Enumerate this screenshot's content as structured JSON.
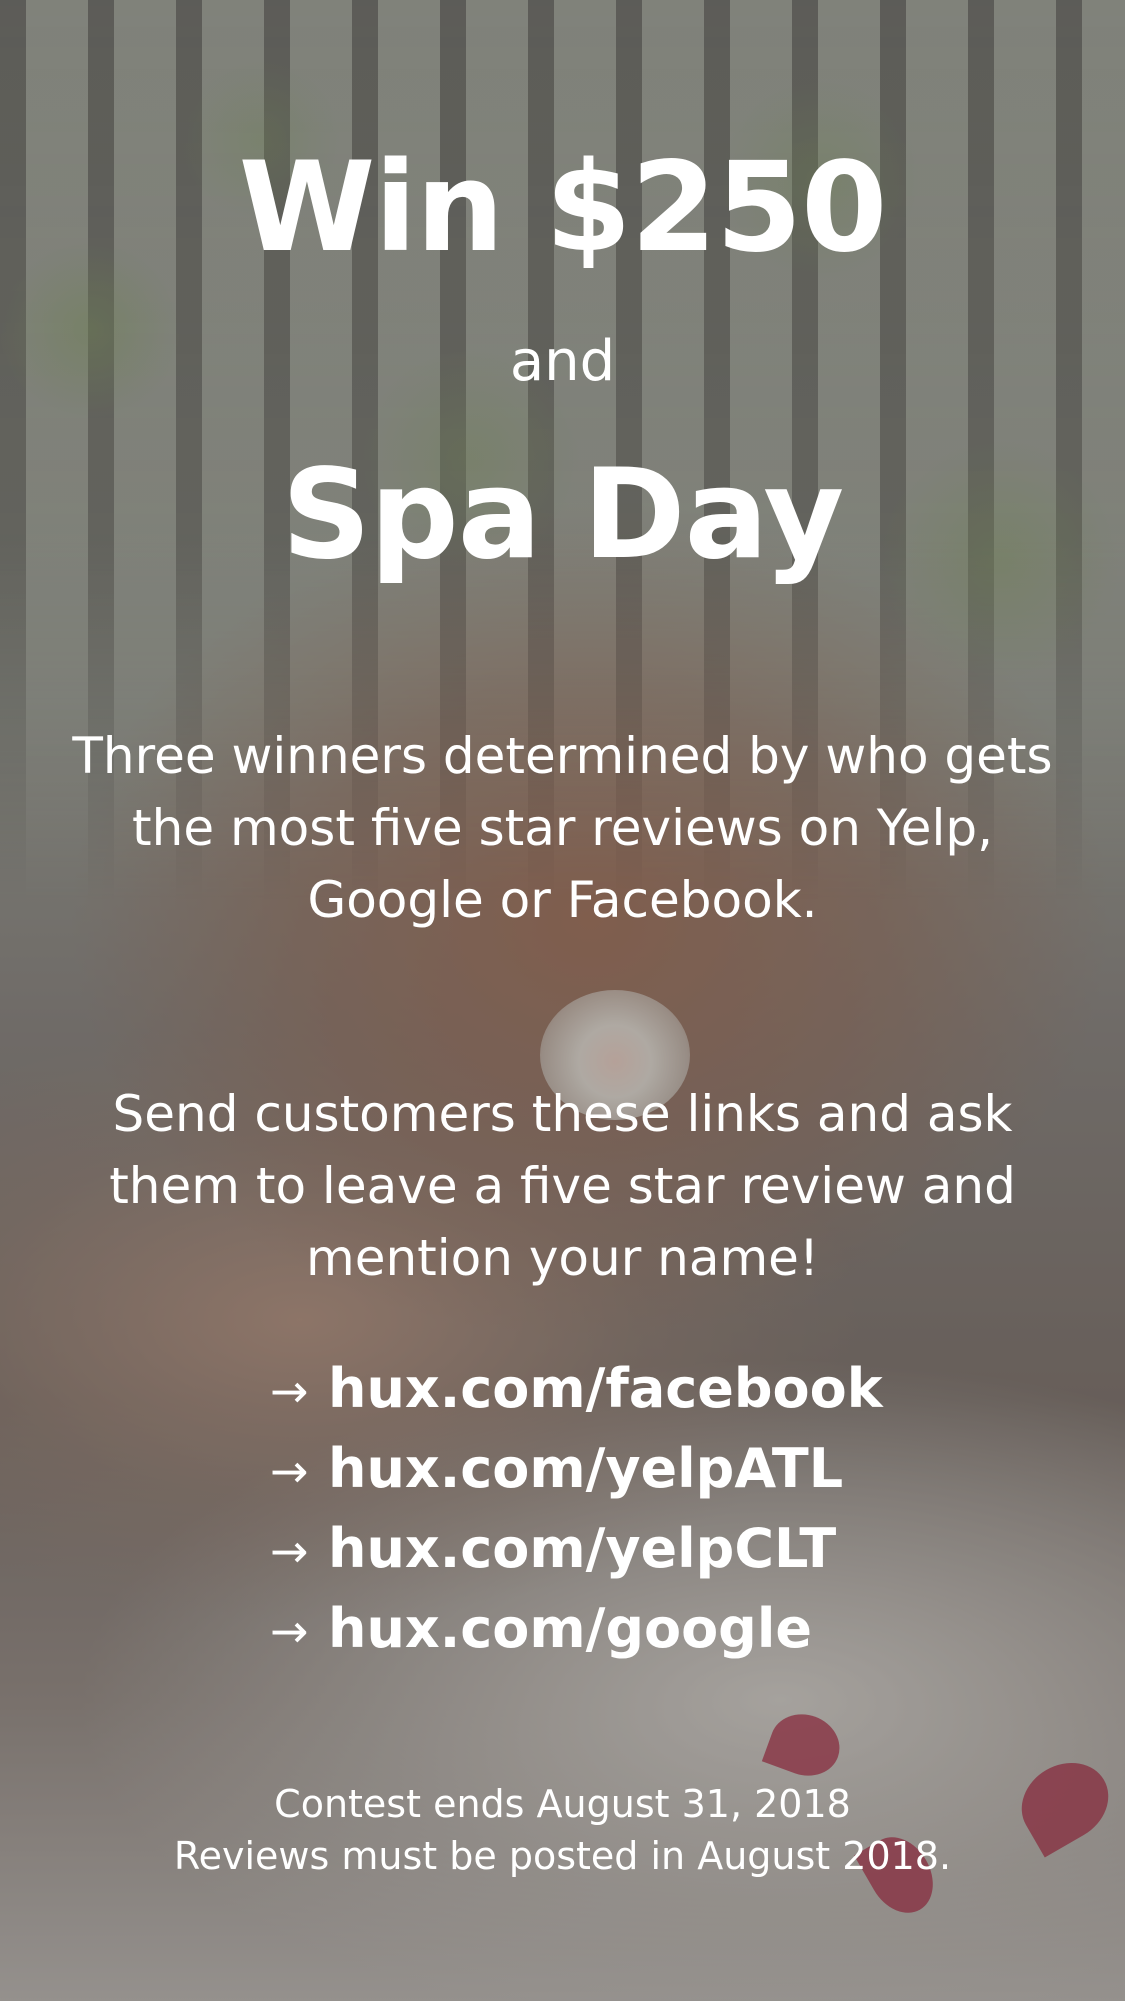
{
  "headline": {
    "prize": "Win $250",
    "connector": "and",
    "bonus": "Spa Day"
  },
  "description": "Three winners determined by who gets the most five star reviews on Yelp, Google or Facebook.",
  "instructions": "Send customers these links and ask them to leave a five star review and mention your name!",
  "links": [
    {
      "arrow": "→",
      "text": "hux.com/facebook"
    },
    {
      "arrow": "→",
      "text": "hux.com/yelpATL"
    },
    {
      "arrow": "→",
      "text": "hux.com/yelpCLT"
    },
    {
      "arrow": "→",
      "text": "hux.com/google"
    }
  ],
  "footer": {
    "line1": "Contest ends August 31, 2018",
    "line2": "Reviews must be posted in August 2018."
  },
  "colors": {
    "text": "#ffffff",
    "overlay": "#5a5855"
  }
}
